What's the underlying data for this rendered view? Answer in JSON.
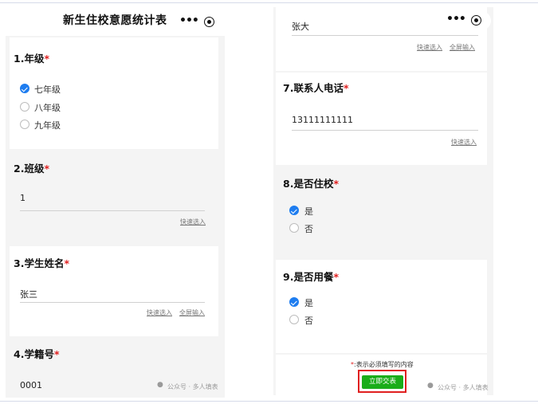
{
  "left": {
    "title": "新生住校意愿统计表",
    "q1": {
      "num": "1.年级",
      "req": "*",
      "options": [
        "七年级",
        "八年级",
        "九年级"
      ],
      "selected": 0
    },
    "q2": {
      "num": "2.班级",
      "req": "*",
      "value": "1",
      "quick": "快速选入"
    },
    "q3": {
      "num": "3.学生姓名",
      "req": "*",
      "value": "张三",
      "quick": "快速选入",
      "full": "全屏输入"
    },
    "q4": {
      "num": "4.学籍号",
      "req": "*",
      "value": "0001"
    },
    "watermark": "公众号 · 多人填表"
  },
  "right": {
    "top_value": "张大",
    "quick": "快速选入",
    "full": "全屏输入",
    "q7": {
      "num": "7.联系人电话",
      "req": "*",
      "value": "13111111111",
      "quick": "快速选入"
    },
    "q8": {
      "num": "8.是否住校",
      "req": "*",
      "options": [
        "是",
        "否"
      ],
      "selected": 0
    },
    "q9": {
      "num": "9.是否用餐",
      "req": "*",
      "options": [
        "是",
        "否"
      ],
      "selected": 0
    },
    "note_star": "*",
    "note": ":表示必须填写的内容",
    "submit": "立即交表",
    "watermark": "公众号 · 多人填表"
  },
  "icons": {
    "more": "more-dots-icon",
    "target": "target-icon",
    "watermark": "wechat-icon"
  },
  "colors": {
    "accent": "#1e7df0",
    "required": "#e02020",
    "submit": "#1aad19"
  }
}
